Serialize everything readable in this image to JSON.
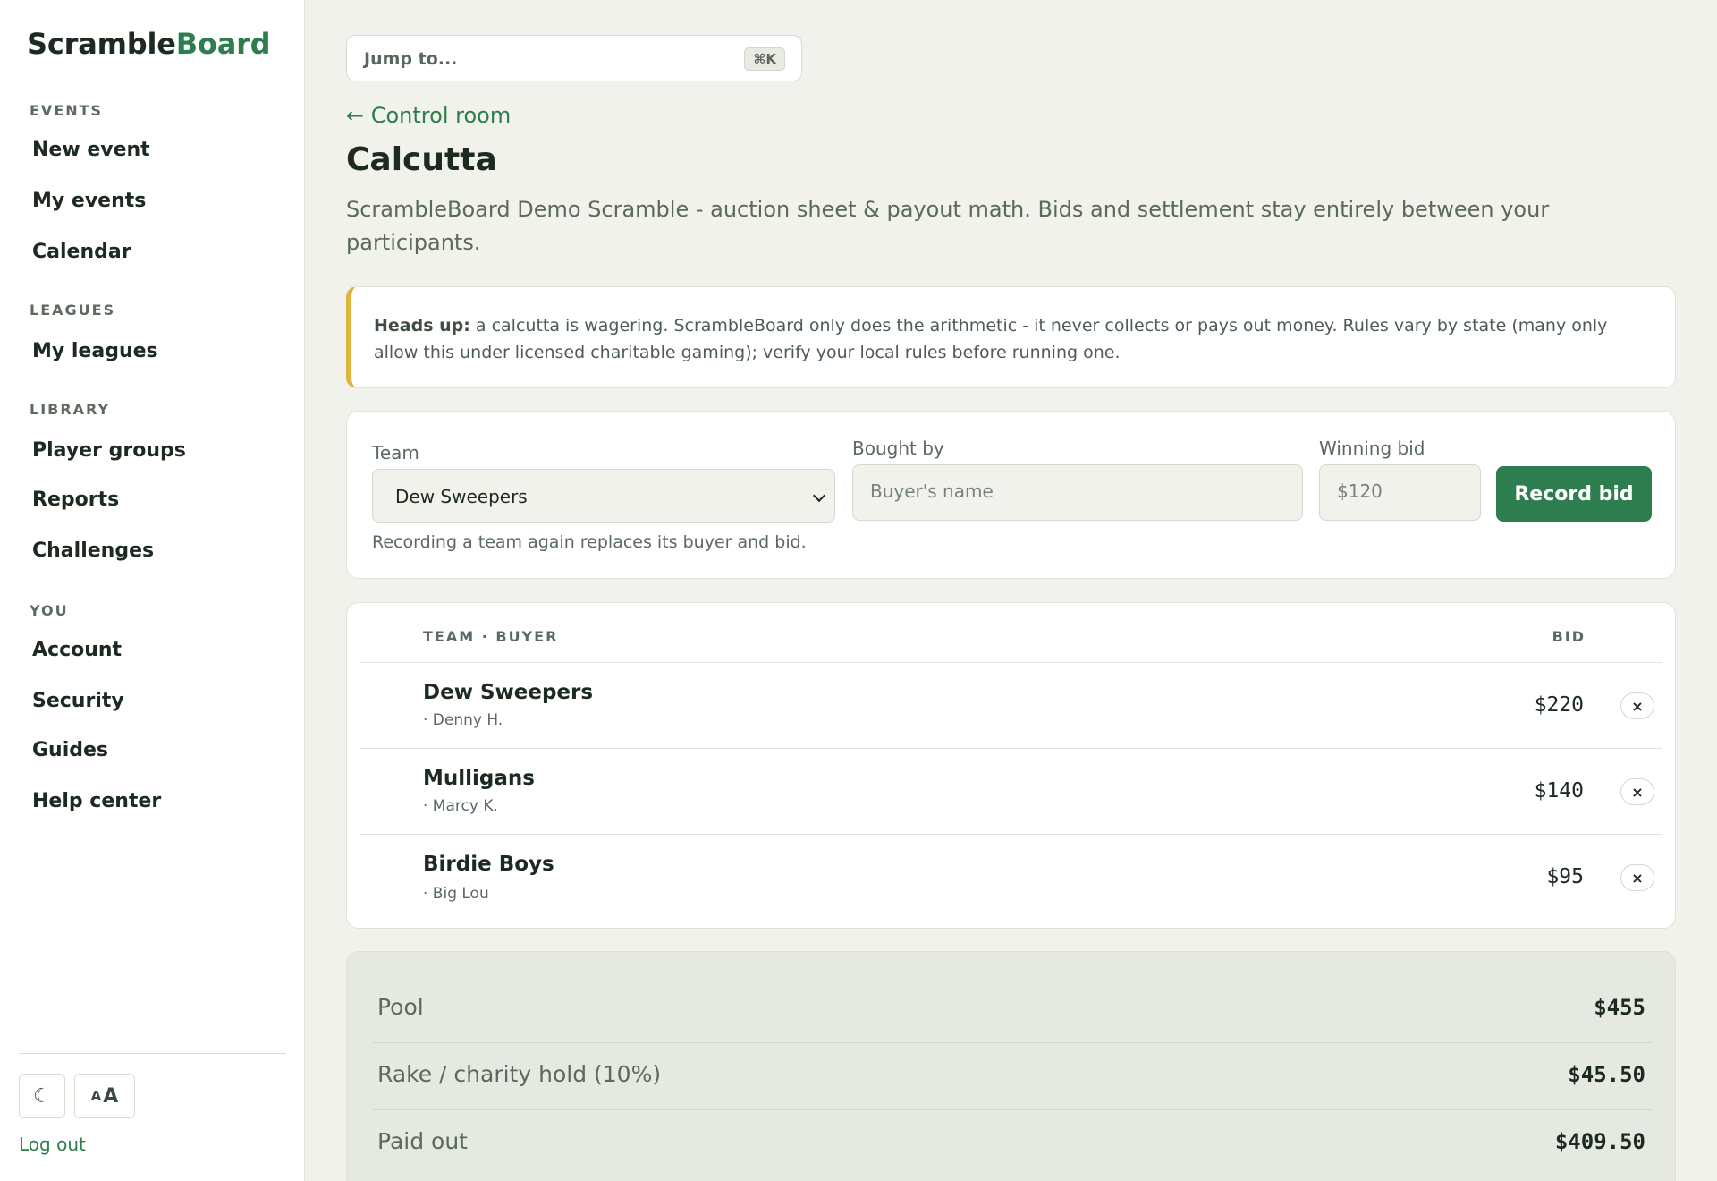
{
  "brand": {
    "part1": "Scramble",
    "part2": "Board"
  },
  "sidebar": {
    "sections": [
      {
        "label": "EVENTS",
        "items": [
          "New event",
          "My events",
          "Calendar"
        ]
      },
      {
        "label": "LEAGUES",
        "items": [
          "My leagues"
        ]
      },
      {
        "label": "LIBRARY",
        "items": [
          "Player groups",
          "Reports",
          "Challenges"
        ]
      },
      {
        "label": "YOU",
        "items": [
          "Account",
          "Security",
          "Guides",
          "Help center"
        ]
      }
    ],
    "theme_toggle_glyph": "☾",
    "text_size_small": "A",
    "text_size_big": "A",
    "logout": "Log out"
  },
  "search": {
    "placeholder": "Jump to...",
    "shortcut": "⌘K"
  },
  "back_link": "← Control room",
  "page": {
    "title": "Calcutta",
    "subtitle": "ScrambleBoard Demo Scramble - auction sheet & payout math. Bids and settlement stay entirely between your participants."
  },
  "alert": {
    "lead": "Heads up:",
    "text": " a calcutta is wagering. ScrambleBoard only does the arithmetic - it never collects or pays out money. Rules vary by state (many only allow this under licensed charitable gaming); verify your local rules before running one."
  },
  "form": {
    "team_label": "Team",
    "team_value": "Dew Sweepers",
    "buyer_label": "Bought by",
    "buyer_placeholder": "Buyer's name",
    "bid_label": "Winning bid",
    "bid_placeholder": "$120",
    "submit": "Record bid",
    "hint": "Recording a team again replaces its buyer and bid."
  },
  "table": {
    "headers": {
      "team": "TEAM · BUYER",
      "bid": "BID"
    },
    "delete_glyph": "×",
    "rows": [
      {
        "team": "Dew Sweepers",
        "buyer": "· Denny H.",
        "bid": "$220"
      },
      {
        "team": "Mulligans",
        "buyer": "· Marcy K.",
        "bid": "$140"
      },
      {
        "team": "Birdie Boys",
        "buyer": "· Big Lou",
        "bid": "$95"
      }
    ]
  },
  "summary": [
    {
      "label": "Pool",
      "value": "$455"
    },
    {
      "label": "Rake / charity hold (10%)",
      "value": "$45.50"
    },
    {
      "label": "Paid out",
      "value": "$409.50"
    }
  ],
  "colors": {
    "accent": "#2e7d4f",
    "warning": "#e0b33c",
    "background": "#f1f2ec"
  }
}
